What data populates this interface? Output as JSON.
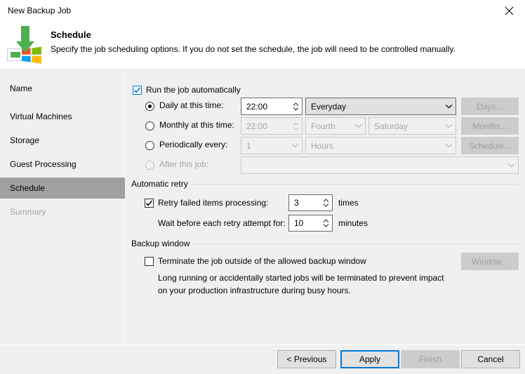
{
  "window": {
    "title": "New Backup Job",
    "close_icon": "close-icon"
  },
  "header": {
    "title": "Schedule",
    "subtitle": "Specify the job scheduling options. If you do not set the schedule, the job will need to be controlled manually.",
    "icon": "schedule-backup-icon"
  },
  "sidebar": {
    "items": [
      {
        "label": "Name",
        "state": "normal"
      },
      {
        "label": "Virtual Machines",
        "state": "normal"
      },
      {
        "label": "Storage",
        "state": "normal"
      },
      {
        "label": "Guest Processing",
        "state": "normal"
      },
      {
        "label": "Schedule",
        "state": "selected"
      },
      {
        "label": "Summary",
        "state": "disabled"
      }
    ]
  },
  "main": {
    "run_automatically": {
      "label": "Run the job automatically",
      "checked": true
    },
    "daily": {
      "label": "Daily at this time:",
      "selected": true,
      "time_value": "22:00",
      "frequency_value": "Everyday",
      "button_label": "Days..."
    },
    "monthly": {
      "label": "Monthly at this time:",
      "selected": false,
      "time_value": "22:00",
      "ordinal_value": "Fourth",
      "weekday_value": "Saturday",
      "button_label": "Months..."
    },
    "periodically": {
      "label": "Periodically every:",
      "selected": false,
      "interval_value": "1",
      "unit_value": "Hours",
      "button_label": "Schedule..."
    },
    "after_this_job": {
      "label": "After this job:",
      "selected": false,
      "job_value": ""
    },
    "automatic_retry": {
      "group_label": "Automatic retry",
      "retry_checkbox_label": "Retry failed items processing:",
      "retry_checked": true,
      "retry_times_value": "3",
      "retry_times_unit": "times",
      "wait_label": "Wait before each retry attempt for:",
      "wait_value": "10",
      "wait_unit": "minutes"
    },
    "backup_window": {
      "group_label": "Backup window",
      "terminate_label": "Terminate the job outside of the allowed backup window",
      "terminate_checked": false,
      "window_button_label": "Window...",
      "help_line1": "Long running or accidentally started jobs will be terminated to prevent impact",
      "help_line2": "on your production infrastructure during busy hours."
    }
  },
  "footer": {
    "previous_label": "< Previous",
    "apply_label": "Apply",
    "finish_label": "Finish",
    "cancel_label": "Cancel"
  },
  "colors": {
    "accent": "#0078d7",
    "selected_nav": "#a0a0a0",
    "window_bg": "#f0f0f0",
    "header_bg": "#ffffff"
  }
}
